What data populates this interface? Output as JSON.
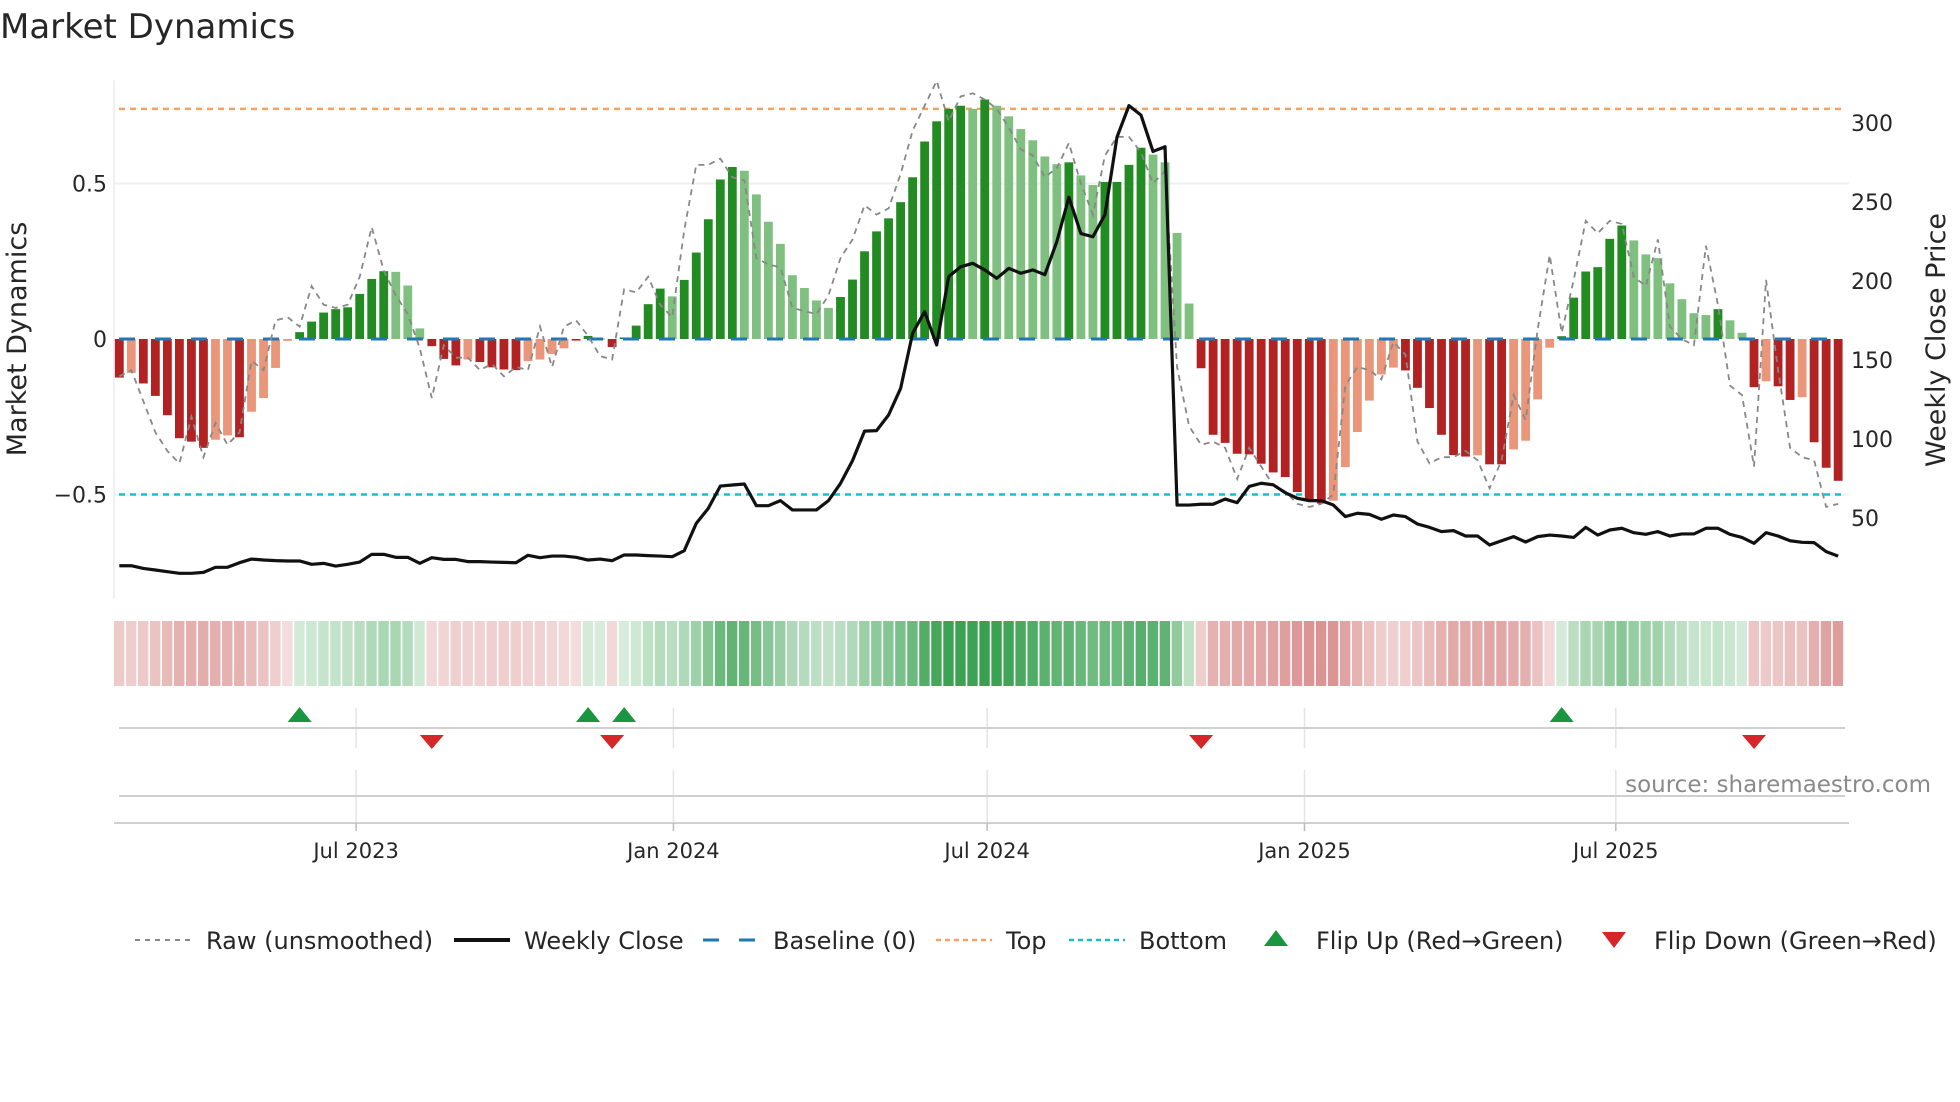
{
  "title": "Market Dynamics",
  "source": "source: sharemaestro.com",
  "colors": {
    "strong_up": "#228b22",
    "weak_up": "#7fbf7f",
    "strong_down": "#b22222",
    "weak_down": "#e9967a",
    "raw": "#888888",
    "close": "#111111",
    "baseline": "#1f77b4",
    "top": "#f4a460",
    "bottom": "#17becf",
    "flip_up": "#1a9641",
    "flip_down": "#d62728"
  },
  "legend": [
    {
      "key": "raw",
      "label": "Raw (unsmoothed)"
    },
    {
      "key": "close",
      "label": "Weekly Close"
    },
    {
      "key": "baseline",
      "label": "Baseline (0)"
    },
    {
      "key": "top",
      "label": "Top"
    },
    {
      "key": "bottom",
      "label": "Bottom"
    },
    {
      "key": "flip_up",
      "label": "Flip Up (Red→Green)"
    },
    {
      "key": "flip_down",
      "label": "Flip Down (Green→Red)"
    }
  ],
  "chart_data": {
    "type": "bar",
    "title": "Market Dynamics",
    "xlabel": "",
    "ylabel": "Market Dynamics",
    "y2label": "Weekly Close Price",
    "ylim": [
      -0.77,
      0.84
    ],
    "y2lim": [
      8,
      330
    ],
    "yticks": [
      {
        "v": 0.5,
        "label": "0.5"
      },
      {
        "v": 0,
        "label": "0"
      },
      {
        "v": -0.5,
        "label": "−0.5"
      }
    ],
    "y2ticks": [
      {
        "v": 300,
        "label": "300"
      },
      {
        "v": 250,
        "label": "250"
      },
      {
        "v": 200,
        "label": "200"
      },
      {
        "v": 150,
        "label": "150"
      },
      {
        "v": 100,
        "label": "100"
      },
      {
        "v": 50,
        "label": "50"
      }
    ],
    "xticks": [
      {
        "week": 19.7,
        "label": "Jul 2023"
      },
      {
        "week": 46.1,
        "label": "Jan 2024"
      },
      {
        "week": 72.2,
        "label": "Jul 2024"
      },
      {
        "week": 98.6,
        "label": "Jan 2025"
      },
      {
        "week": 124.5,
        "label": "Jul 2025"
      }
    ],
    "top_level": 0.74,
    "bottom_level": -0.5,
    "baseline": 0,
    "x_unit": "week index",
    "smoothed": [
      -0.124,
      -0.109,
      -0.143,
      -0.183,
      -0.245,
      -0.319,
      -0.33,
      -0.35,
      -0.324,
      -0.31,
      -0.316,
      -0.234,
      -0.19,
      -0.093,
      -0.006,
      0.022,
      0.056,
      0.085,
      0.096,
      0.102,
      0.145,
      0.193,
      0.218,
      0.216,
      0.172,
      0.034,
      -0.023,
      -0.064,
      -0.085,
      -0.066,
      -0.074,
      -0.091,
      -0.098,
      -0.1,
      -0.071,
      -0.066,
      -0.048,
      -0.03,
      -0.005,
      0.01,
      0.002,
      -0.026,
      0.005,
      0.043,
      0.112,
      0.162,
      0.137,
      0.19,
      0.278,
      0.385,
      0.513,
      0.553,
      0.541,
      0.465,
      0.377,
      0.306,
      0.205,
      0.164,
      0.124,
      0.1,
      0.135,
      0.191,
      0.282,
      0.346,
      0.388,
      0.44,
      0.52,
      0.635,
      0.7,
      0.74,
      0.75,
      0.74,
      0.77,
      0.75,
      0.716,
      0.675,
      0.639,
      0.587,
      0.562,
      0.568,
      0.526,
      0.495,
      0.505,
      0.505,
      0.56,
      0.615,
      0.593,
      0.568,
      0.341,
      0.114,
      -0.094,
      -0.308,
      -0.334,
      -0.369,
      -0.371,
      -0.401,
      -0.429,
      -0.444,
      -0.492,
      -0.518,
      -0.529,
      -0.52,
      -0.412,
      -0.299,
      -0.198,
      -0.114,
      -0.092,
      -0.101,
      -0.157,
      -0.222,
      -0.308,
      -0.373,
      -0.378,
      -0.374,
      -0.403,
      -0.403,
      -0.355,
      -0.327,
      -0.194,
      -0.028,
      0.009,
      0.133,
      0.217,
      0.231,
      0.322,
      0.365,
      0.317,
      0.272,
      0.26,
      0.179,
      0.128,
      0.083,
      0.077,
      0.096,
      0.06,
      0.02,
      -0.155,
      -0.136,
      -0.152,
      -0.196,
      -0.187,
      -0.332,
      -0.414,
      -0.456
    ],
    "strength": "SWSSSSSSWWSWWWWSSSSSSSSWWWSSSWSSSSWWWWSSWSSSSSWSSSSSWWWWWWWWSSSSSSSSSSSWSWWWWWWSWWSSSSWWWWSSSSSSSSSSSWWWWWWSSSSSSWSSWWWWSSSSSSWWWWWWWSWWSWSSWSSS",
    "raw": [
      -0.12,
      -0.1,
      -0.2,
      -0.3,
      -0.36,
      -0.4,
      -0.25,
      -0.38,
      -0.27,
      -0.34,
      -0.3,
      -0.07,
      -0.1,
      0.06,
      0.07,
      0.04,
      0.17,
      0.11,
      0.1,
      0.11,
      0.2,
      0.36,
      0.22,
      0.14,
      0.08,
      -0.03,
      -0.19,
      -0.02,
      -0.06,
      -0.06,
      -0.1,
      -0.08,
      -0.12,
      -0.09,
      -0.1,
      0.04,
      -0.09,
      0.04,
      0.06,
      0.01,
      -0.055,
      -0.066,
      0.16,
      0.15,
      0.2,
      0.11,
      0.07,
      0.35,
      0.56,
      0.56,
      0.58,
      0.52,
      0.51,
      0.26,
      0.24,
      0.23,
      0.1,
      0.09,
      0.08,
      0.14,
      0.26,
      0.32,
      0.43,
      0.4,
      0.42,
      0.53,
      0.67,
      0.75,
      0.83,
      0.7,
      0.78,
      0.79,
      0.77,
      0.74,
      0.68,
      0.61,
      0.59,
      0.52,
      0.55,
      0.63,
      0.5,
      0.4,
      0.59,
      0.65,
      0.65,
      0.6,
      0.5,
      0.54,
      -0.09,
      -0.28,
      -0.34,
      -0.33,
      -0.35,
      -0.45,
      -0.35,
      -0.41,
      -0.47,
      -0.49,
      -0.53,
      -0.54,
      -0.53,
      -0.5,
      -0.15,
      -0.09,
      -0.1,
      -0.13,
      -0.01,
      -0.05,
      -0.33,
      -0.4,
      -0.38,
      -0.38,
      -0.36,
      -0.39,
      -0.48,
      -0.39,
      -0.18,
      -0.26,
      0.03,
      0.27,
      0.02,
      0.19,
      0.38,
      0.34,
      0.38,
      0.37,
      0.2,
      0.17,
      0.32,
      0.04,
      0,
      -0.02,
      0.3,
      0.11,
      -0.15,
      -0.18,
      -0.41,
      0.19,
      -0.1,
      -0.35,
      -0.38,
      -0.39,
      -0.54,
      -0.53
    ],
    "close": [
      19.8,
      19.8,
      18.1,
      17.1,
      16,
      15,
      15,
      15.6,
      18.8,
      18.8,
      21.7,
      24,
      23.4,
      23,
      22.8,
      22.8,
      20.7,
      21.3,
      19.6,
      20.7,
      22.1,
      27,
      27,
      25.1,
      25.1,
      21.3,
      24.9,
      23.8,
      23.8,
      22.4,
      22.4,
      22.1,
      21.9,
      21.7,
      26.4,
      24.9,
      25.9,
      25.9,
      25.1,
      23.4,
      24,
      23,
      26.6,
      26.6,
      26.2,
      25.9,
      25.5,
      29.3,
      46.6,
      56.1,
      70.2,
      70.9,
      71.5,
      57.8,
      57.8,
      61,
      55.1,
      55.1,
      55.1,
      61,
      71.9,
      86.3,
      105,
      105.3,
      115.2,
      132,
      166.9,
      180.6,
      159.5,
      202.8,
      209,
      211.2,
      207,
      201.7,
      208,
      204.9,
      207,
      204,
      225,
      253,
      230,
      228,
      242,
      291,
      311,
      305,
      282,
      285,
      58.2,
      58.2,
      58.7,
      58.7,
      62,
      59.7,
      70,
      72,
      71,
      66,
      62.5,
      61,
      61,
      58.2,
      50.9,
      53,
      52.3,
      49.2,
      51.9,
      50.9,
      46.2,
      44.1,
      41.4,
      42,
      38.6,
      38.6,
      32.9,
      35.6,
      38.2,
      34.8,
      38.2,
      39.2,
      38.6,
      37.7,
      44.1,
      39.2,
      42.4,
      43.5,
      40.7,
      39.7,
      41.4,
      38.6,
      39.9,
      39.9,
      43.5,
      43.5,
      39.7,
      37.7,
      34,
      40.7,
      38.6,
      35.6,
      34.6,
      34.4,
      28.7,
      25.9
    ],
    "flips_up": [
      15,
      39,
      42,
      120
    ],
    "flips_down": [
      26,
      41,
      90,
      136
    ]
  }
}
